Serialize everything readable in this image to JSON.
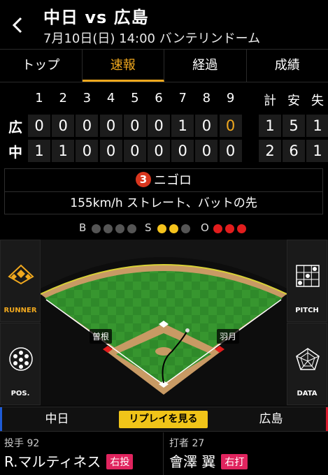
{
  "header": {
    "title": "中日 vs 広島",
    "subtitle": "7月10日(日) 14:00 バンテリンドーム"
  },
  "tabs": [
    {
      "label": "トップ",
      "active": false
    },
    {
      "label": "速報",
      "active": true
    },
    {
      "label": "経過",
      "active": false
    },
    {
      "label": "成績",
      "active": false
    }
  ],
  "scoreboard": {
    "innings": [
      "1",
      "2",
      "3",
      "4",
      "5",
      "6",
      "7",
      "8",
      "9"
    ],
    "totals_headers": [
      "計",
      "安",
      "失"
    ],
    "rows": [
      {
        "team": "広",
        "scores": [
          "0",
          "0",
          "0",
          "0",
          "0",
          "0",
          "1",
          "0",
          "0"
        ],
        "totals": [
          "1",
          "5",
          "1"
        ]
      },
      {
        "team": "中",
        "scores": [
          "1",
          "1",
          "0",
          "0",
          "0",
          "0",
          "0",
          "0",
          "0"
        ],
        "totals": [
          "2",
          "6",
          "1"
        ]
      }
    ]
  },
  "play": {
    "batter_number": "3",
    "result": "ニゴロ",
    "pitch": "155km/h ストレート、バットの先"
  },
  "count": {
    "b_label": "B",
    "s_label": "S",
    "o_label": "O",
    "balls": 0,
    "strikes": 2,
    "outs": 3
  },
  "side_buttons": {
    "runner": "RUNNER",
    "pos": "POS.",
    "pitch": "PITCH",
    "data": "DATA"
  },
  "field": {
    "runner_third": "曽根",
    "runner_first": "羽月"
  },
  "teambar": {
    "home": "中日",
    "replay": "リプレイを見る",
    "away": "広島"
  },
  "pitcher": {
    "role": "投手 92",
    "name": "R.マルティネス",
    "hand": "右投"
  },
  "batter": {
    "role": "打者 27",
    "name": "會澤 翼",
    "hand": "右打"
  }
}
